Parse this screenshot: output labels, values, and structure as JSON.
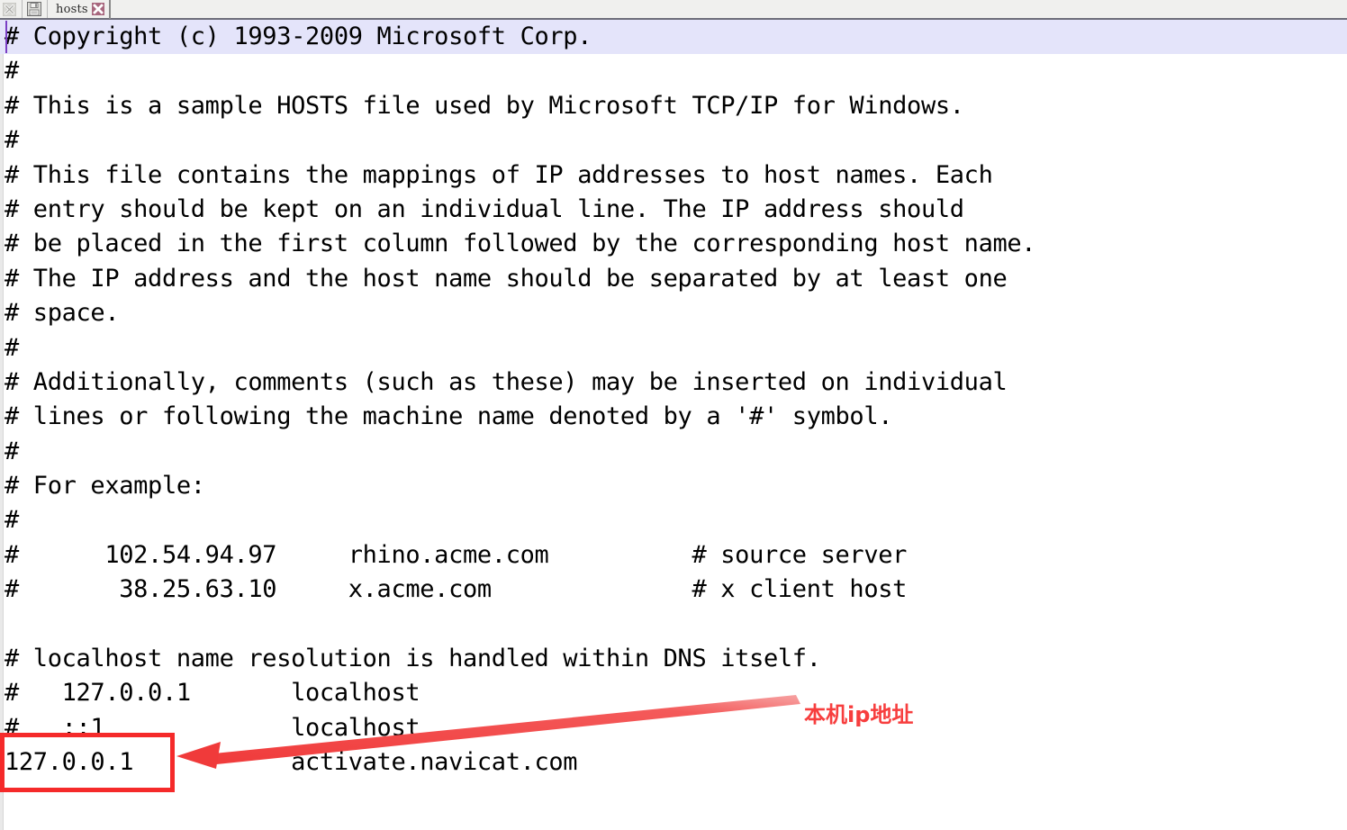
{
  "window": {
    "title": "hosts"
  },
  "tabbar": {
    "close_all_icon": "close-x-icon",
    "save_icon": "save-floppy-icon",
    "tab_label": "hosts",
    "tab_close_icon": "close-x-icon"
  },
  "editor": {
    "filename": "hosts",
    "highlight_color": "#e4e4fa",
    "caret_color": "#7a3fc4",
    "lines": [
      "# Copyright (c) 1993-2009 Microsoft Corp.",
      "#",
      "# This is a sample HOSTS file used by Microsoft TCP/IP for Windows.",
      "#",
      "# This file contains the mappings of IP addresses to host names. Each",
      "# entry should be kept on an individual line. The IP address should",
      "# be placed in the first column followed by the corresponding host name.",
      "# The IP address and the host name should be separated by at least one",
      "# space.",
      "#",
      "# Additionally, comments (such as these) may be inserted on individual",
      "# lines or following the machine name denoted by a '#' symbol.",
      "#",
      "# For example:",
      "#",
      "#      102.54.94.97     rhino.acme.com          # source server",
      "#       38.25.63.10     x.acme.com              # x client host",
      "",
      "# localhost name resolution is handled within DNS itself.",
      "#   127.0.0.1       localhost",
      "#   ::1             localhost",
      "127.0.0.1           activate.navicat.com"
    ],
    "highlighted_line_index": 0
  },
  "annotations": {
    "note_text": "本机ip地址",
    "note_color": "#f73e3e",
    "box_color": "#f52a2a",
    "boxed_value": "127.0.0.1",
    "arrow_color": "#f03a3a"
  }
}
